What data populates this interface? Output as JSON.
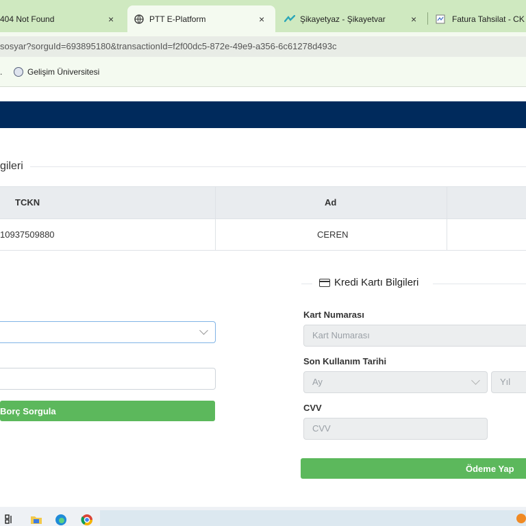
{
  "browser": {
    "tabs": [
      {
        "title": "404 Not Found",
        "active": false
      },
      {
        "title": "PTT E-Platform",
        "active": true
      },
      {
        "title": "Şikayetyaz - Şikayetvar",
        "active": false
      },
      {
        "title": "Fatura Tahsilat - CK E",
        "active": false
      }
    ],
    "close_glyph": "×",
    "url": "sosyar?sorguId=693895180&transactionId=f2f00dc5-872e-49e9-a356-6c61278d493c",
    "bookmarks": [
      {
        "label": "."
      },
      {
        "label": "Gelişim Üniversitesi",
        "icon": "university-logo-icon"
      }
    ]
  },
  "page": {
    "section_title": "gileri",
    "table": {
      "headers": [
        "TCKN",
        "Ad"
      ],
      "rows": [
        [
          "10937509880",
          "CEREN"
        ]
      ]
    },
    "left_form": {
      "select_value": "",
      "text_value": "",
      "query_button": "Borç Sorgula"
    },
    "credit_card": {
      "title": "Kredi Kartı Bilgileri",
      "icon": "credit-card-icon",
      "card_number_label": "Kart Numarası",
      "card_number_placeholder": "Kart Numarası",
      "expiry_label": "Son Kullanım Tarihi",
      "month_placeholder": "Ay",
      "year_placeholder": "Yıl",
      "cvv_label": "CVV",
      "cvv_placeholder": "CVV",
      "pay_button": "Ödeme Yap"
    }
  },
  "colors": {
    "nav_band": "#002a5c",
    "tab_bar": "#cfe9c0",
    "button_green": "#5cb85c"
  }
}
